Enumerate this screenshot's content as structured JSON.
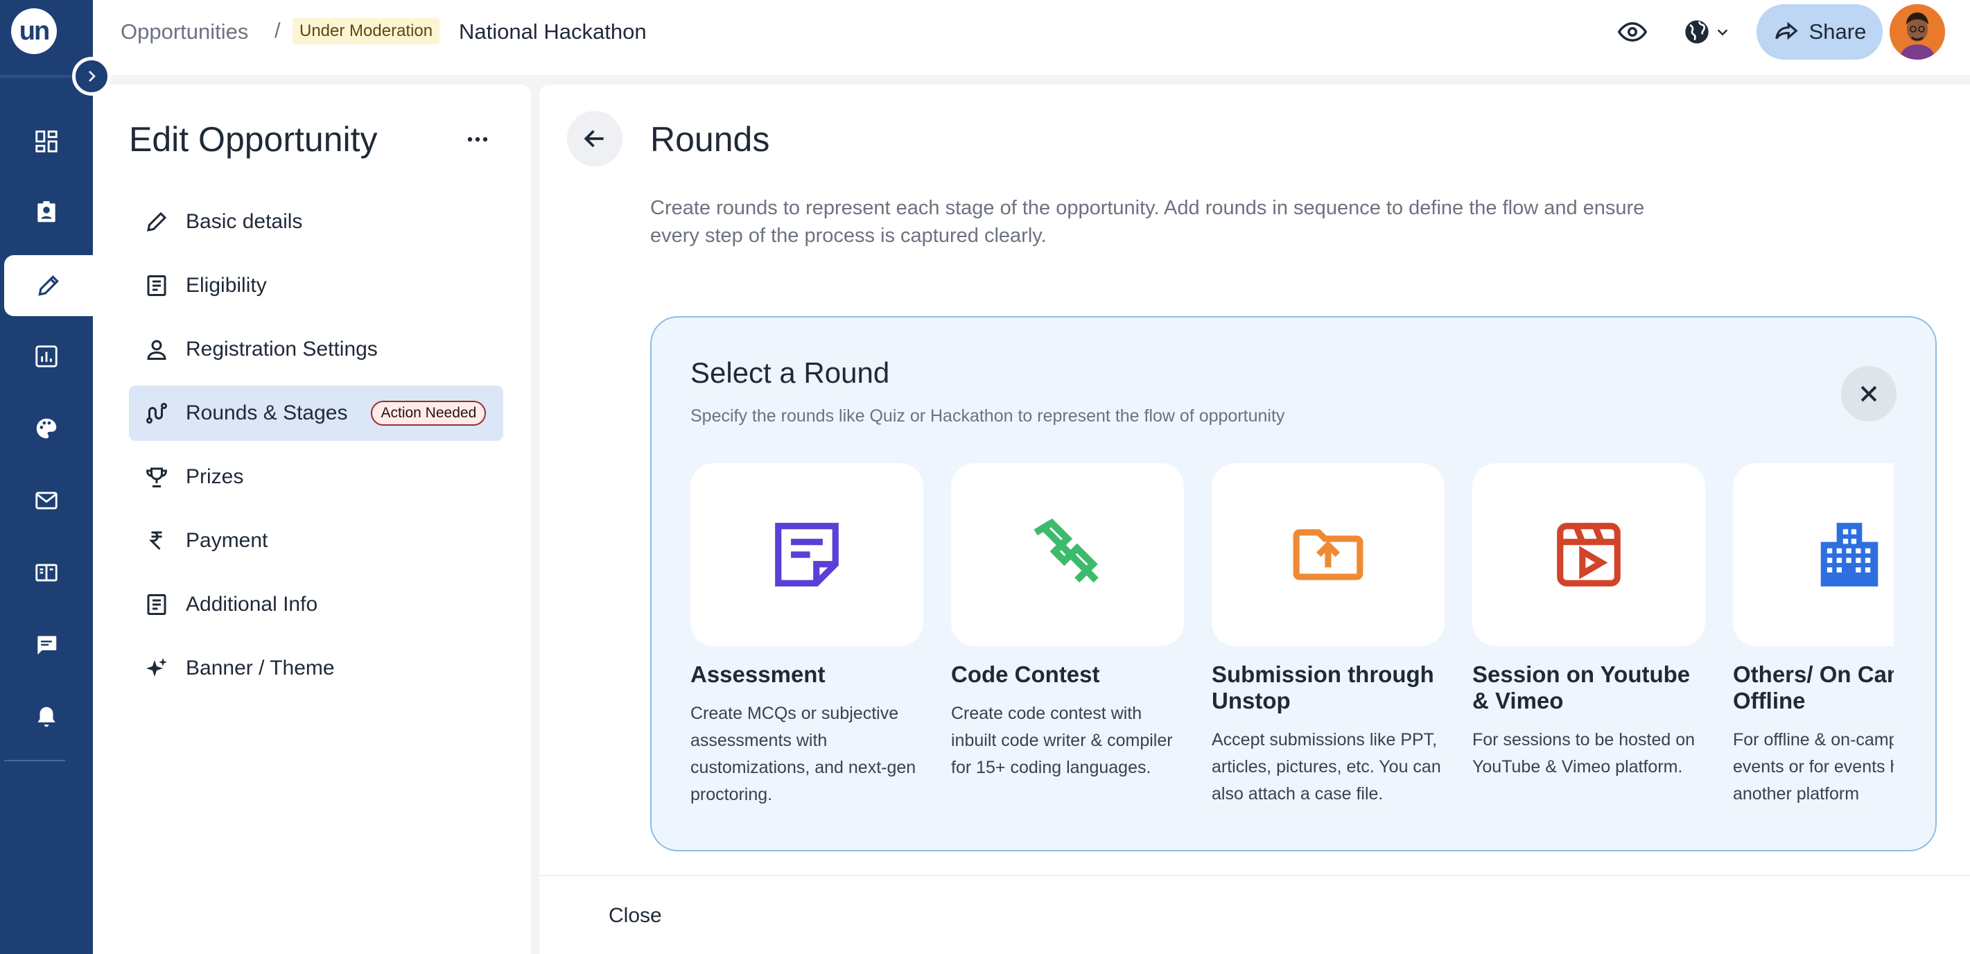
{
  "app": {
    "logo_text": "un"
  },
  "breadcrumb": {
    "root": "Opportunities",
    "separator": "/",
    "status_badge": "Under Moderation",
    "current": "National Hackathon"
  },
  "topbar": {
    "share_label": "Share"
  },
  "rail": {
    "items": [
      {
        "icon": "dashboard-icon"
      },
      {
        "icon": "contacts-icon"
      },
      {
        "icon": "pencil-icon",
        "active": true
      },
      {
        "icon": "analytics-icon"
      },
      {
        "icon": "palette-icon"
      },
      {
        "icon": "mail-icon"
      },
      {
        "icon": "book-icon"
      },
      {
        "icon": "chat-icon"
      },
      {
        "icon": "bell-icon"
      }
    ]
  },
  "left_panel": {
    "title": "Edit Opportunity",
    "nav": [
      {
        "label": "Basic details",
        "icon": "pencil-icon"
      },
      {
        "label": "Eligibility",
        "icon": "document-icon"
      },
      {
        "label": "Registration Settings",
        "icon": "person-icon"
      },
      {
        "label": "Rounds & Stages",
        "icon": "route-icon",
        "active": true,
        "badge": "Action Needed"
      },
      {
        "label": "Prizes",
        "icon": "trophy-icon"
      },
      {
        "label": "Payment",
        "icon": "rupee-icon"
      },
      {
        "label": "Additional Info",
        "icon": "document-icon"
      },
      {
        "label": "Banner / Theme",
        "icon": "sparkle-icon"
      }
    ]
  },
  "main": {
    "title": "Rounds",
    "description": "Create rounds to represent each stage of the opportunity. Add rounds in sequence to define the flow and ensure every step of the process is captured clearly.",
    "select_round": {
      "title": "Select a Round",
      "subtitle": "Specify the rounds like Quiz or Hackathon to represent the flow of opportunity",
      "cards": [
        {
          "name": "Assessment",
          "desc": "Create MCQs or subjective assessments with customizations, and next-gen proctoring.",
          "icon": "note-icon",
          "color": "#5b3fd6"
        },
        {
          "name": "Code Contest",
          "desc": "Create code contest with inbuilt code writer & compiler for 15+ coding languages.",
          "icon": "code-icon",
          "color": "#3dbb6c"
        },
        {
          "name": "Submission through Unstop",
          "desc": "Accept submissions like PPT, articles, pictures, etc. You can also attach a case file.",
          "icon": "folder-upload-icon",
          "color": "#ee8a34"
        },
        {
          "name": "Session on Youtube & Vimeo",
          "desc": "For sessions to be hosted on YouTube & Vimeo platform.",
          "icon": "video-clap-icon",
          "color": "#d1442a"
        },
        {
          "name": "Others/ On Campus Offline",
          "desc": "For offline & on-campus events or for events hosted on another platform",
          "icon": "building-icon",
          "color": "#2e6fe0"
        }
      ]
    },
    "footer": {
      "close_label": "Close"
    }
  }
}
